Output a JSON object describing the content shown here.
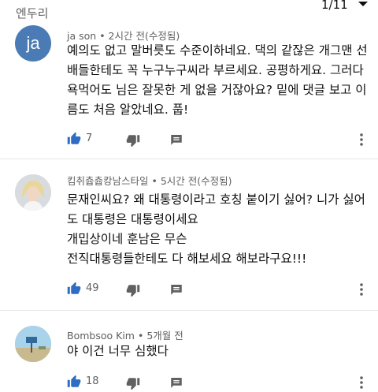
{
  "header": {
    "title": "엔두리",
    "page_indicator": "1/11"
  },
  "comments": [
    {
      "author": "ja son",
      "time": "2시간 전(수정됨)",
      "avatar_text": "ja",
      "avatar_color": "#4a7bb5",
      "lines": [
        "예의도 없고 말버릇도 수준이하네요. 댁의 같잖은 개그맨 선",
        "배들한테도 꼭 누구누구씨라 부르세요. 공평하게요. 그러다",
        "욕먹어도 님은 잘못한 게 없을 거잖아요? 밑에 댓글 보고 이",
        "름도 처음 알았네요. 풉!"
      ],
      "likes": "7"
    },
    {
      "author": "킴취츕츕캉남스타일",
      "time": "5시간 전(수정됨)",
      "lines": [
        "문재인씨요? 왜 대통령이라고 호칭 붙이기 싫어? 니가 싫어",
        "도 대통령은 대통령이세요",
        "개밉상이네 훈남은 무슨",
        "전직대통령들한테도 다 해보세요 해보라구요!!!"
      ],
      "likes": "49"
    },
    {
      "author": "Bombsoo Kim",
      "time": "5개월 전",
      "lines": [
        "야 이건 너무 심했다"
      ],
      "likes": "18"
    }
  ],
  "colors": {
    "accent_like": "#2f6cc3",
    "icon_gray": "#606060",
    "divider": "#e6e6e6"
  },
  "icons": {
    "like": "thumb-up-icon",
    "dislike": "thumb-down-icon",
    "reply": "comment-icon",
    "more": "more-vert-icon",
    "chevron": "chevron-down-icon"
  }
}
